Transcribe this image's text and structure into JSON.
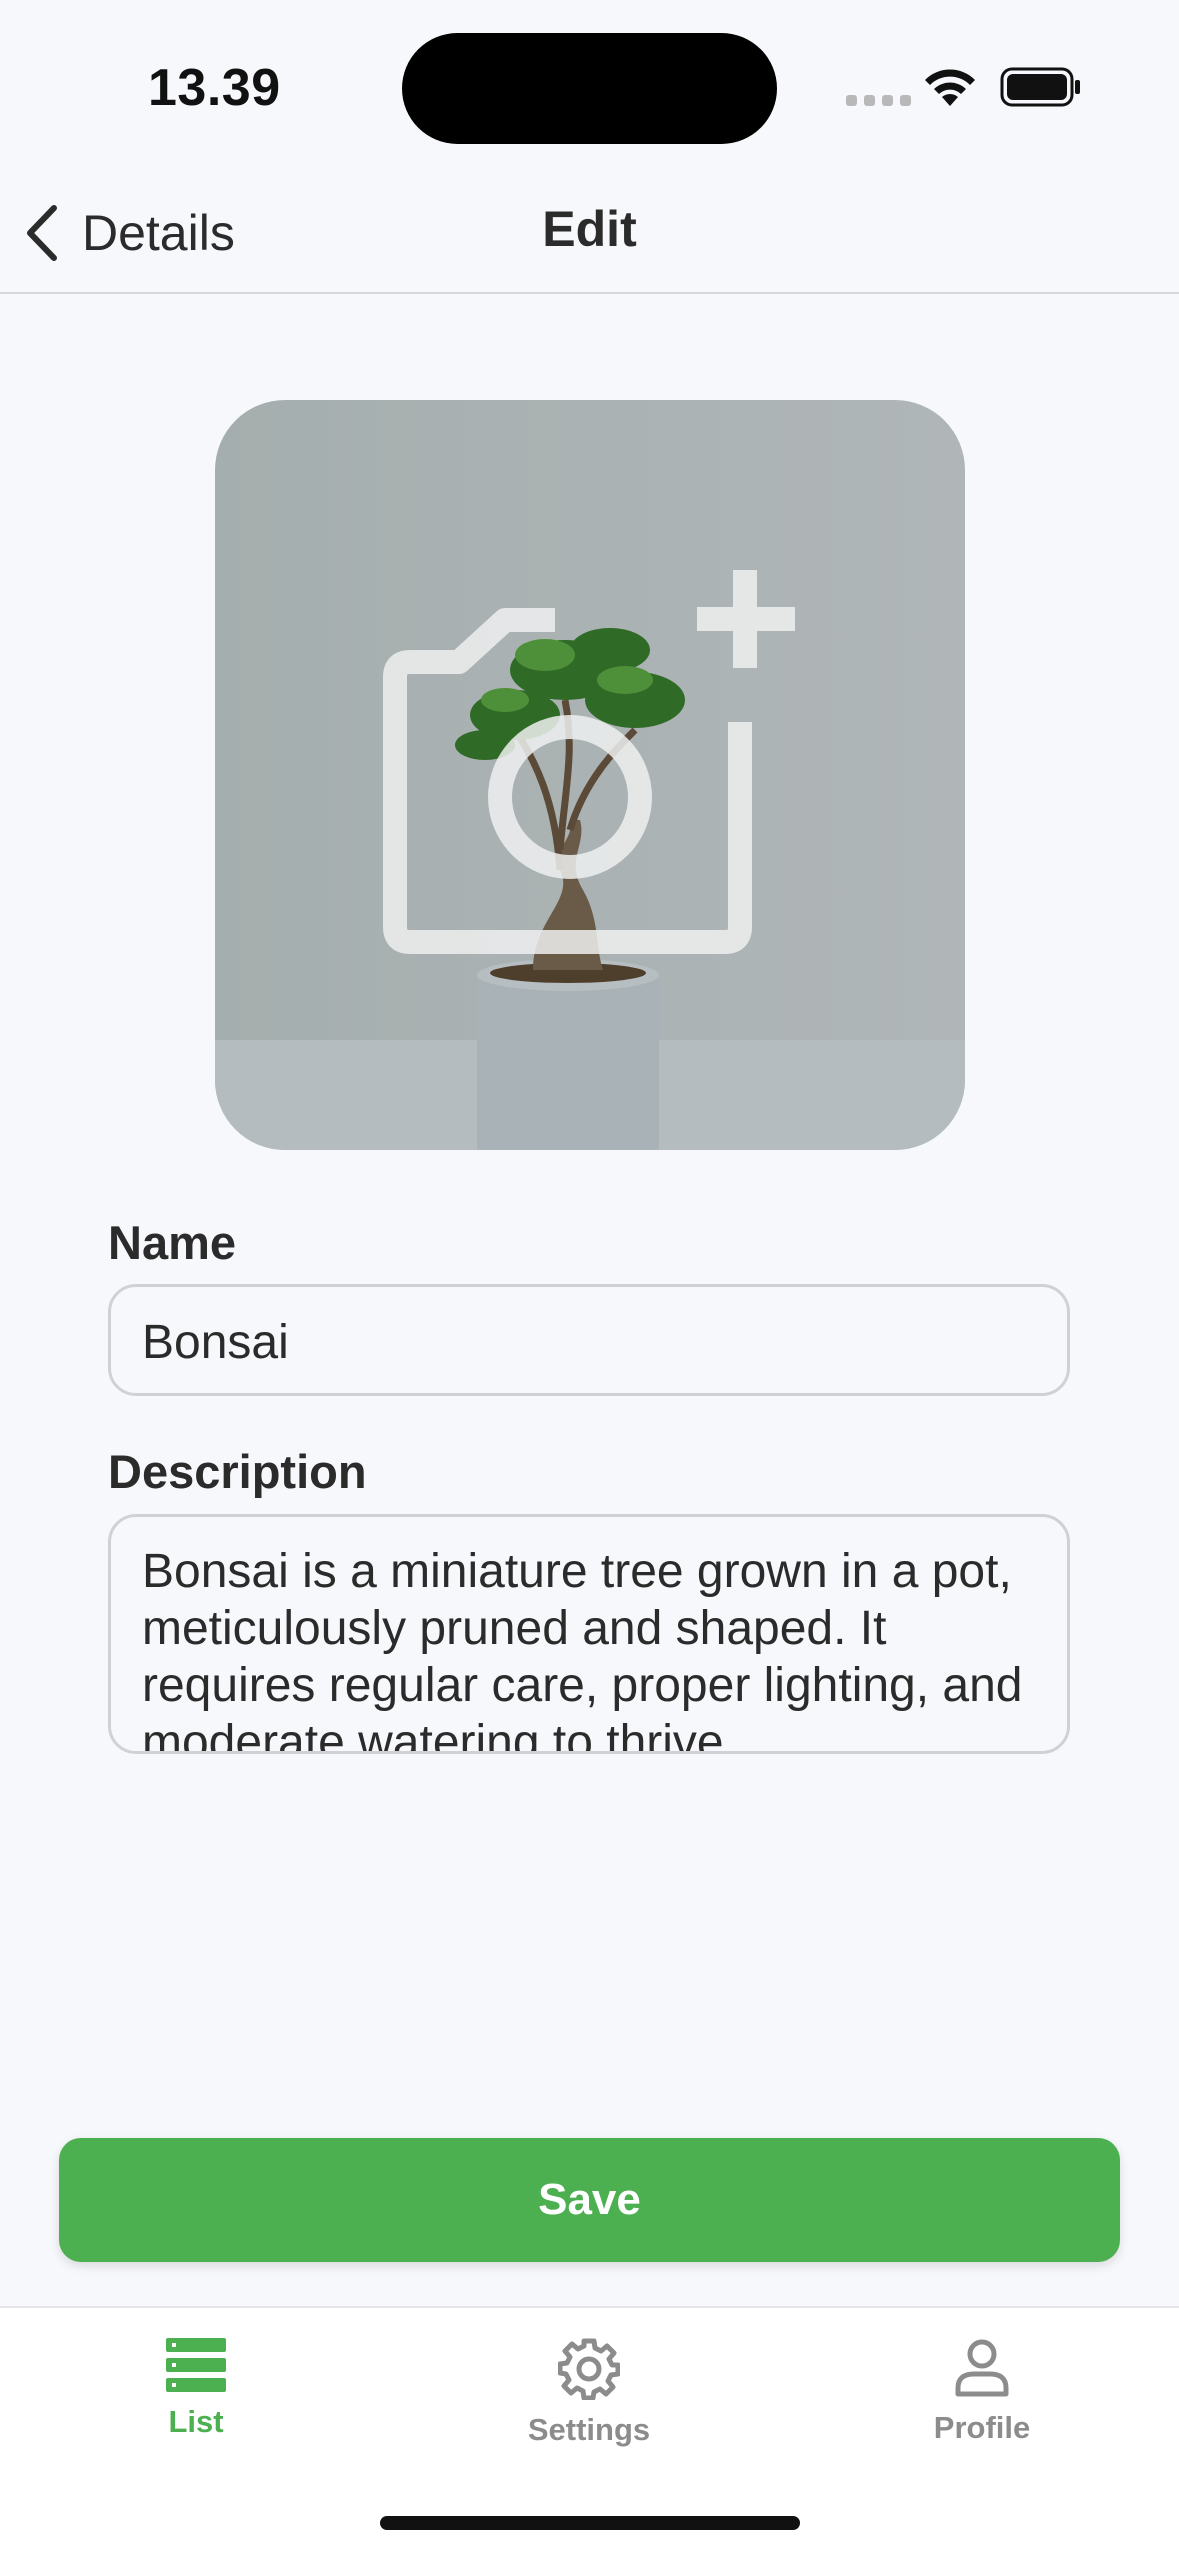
{
  "status_bar": {
    "time": "13.39"
  },
  "nav": {
    "back_label": "Details",
    "title": "Edit"
  },
  "photo": {
    "alt": "Bonsai"
  },
  "form": {
    "name_label": "Name",
    "name_value": "Bonsai",
    "description_label": "Description",
    "description_value": "Bonsai is a miniature tree grown in a pot, meticulously pruned and shaped. It requires regular care, proper lighting, and moderate watering to thrive."
  },
  "save_label": "Save",
  "tabs": [
    {
      "label": "List",
      "icon": "list-icon",
      "active": true
    },
    {
      "label": "Settings",
      "icon": "gear-icon",
      "active": false
    },
    {
      "label": "Profile",
      "icon": "person-icon",
      "active": false
    }
  ],
  "colors": {
    "accent": "#4caf50",
    "inactive": "#8c8c8c",
    "background": "#f7f8fc"
  }
}
